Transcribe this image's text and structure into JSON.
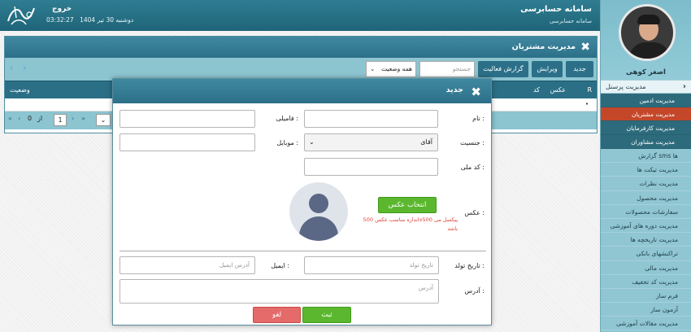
{
  "header": {
    "app_title": "سامانه حسابرسی",
    "app_subtitle": "سامانه حسابرسی",
    "logout": "خروج",
    "date": "دوشنبه 30 تیر 1404",
    "time": "03:32:27"
  },
  "sidebar": {
    "user_name": "اصغر کوهی",
    "section_label": "مدیریت پرسنل",
    "sub_items": [
      "مدیریت ادمین",
      "مدیریت مشتریان",
      "مدیریت کارفرمایان",
      "مدیریت مشاوران"
    ],
    "items": [
      "گزارش sms ها",
      "مدیریت تیکت ها",
      "مدیریت نظرات",
      "مدیریت محصول",
      "سفارشات محصولات",
      "مدیریت دوره های آموزشی",
      "مدیریت تاریخچه ها",
      "تراکنشهای بانکی",
      "مدیریت مالی",
      "مدیریت کد تخفیف",
      "فرم ساز",
      "آزمون ساز",
      "مدیریت مقالات آموزشی"
    ]
  },
  "panel": {
    "title": "مدیریت مشتریان",
    "buttons": {
      "new": "جدید",
      "edit": "ویرایش",
      "report": "گزارش فعالیت"
    },
    "search_placeholder": "جستجو",
    "status_select": "همه وضعیت",
    "columns": {
      "r": "R",
      "photo": "عکس",
      "code": "کد",
      "status": "وضعیت"
    },
    "pager": {
      "page": "1",
      "of": "از",
      "total": "0"
    }
  },
  "modal": {
    "title": "جدید",
    "first_name_label": "نام :",
    "last_name_label": "فامیلی :",
    "gender_label": "جنسیت :",
    "gender_value": "آقای",
    "mobile_label": "موبایل :",
    "national_code_label": "کد ملی :",
    "photo_label": "عکس :",
    "choose_photo": "انتخاب عکس",
    "photo_hint_1": "اندازه مناسب عکس 500x500 پیکسل می",
    "photo_hint_2": "باشد",
    "birth_label": "تاریخ تولد :",
    "birth_placeholder": "تاریخ تولد",
    "email_label": "ایمیل :",
    "email_placeholder": "آدرس ایمیل",
    "address_label": "آدرس :",
    "address_placeholder": "آدرس",
    "submit": "ثبت",
    "cancel": "لغو"
  }
}
